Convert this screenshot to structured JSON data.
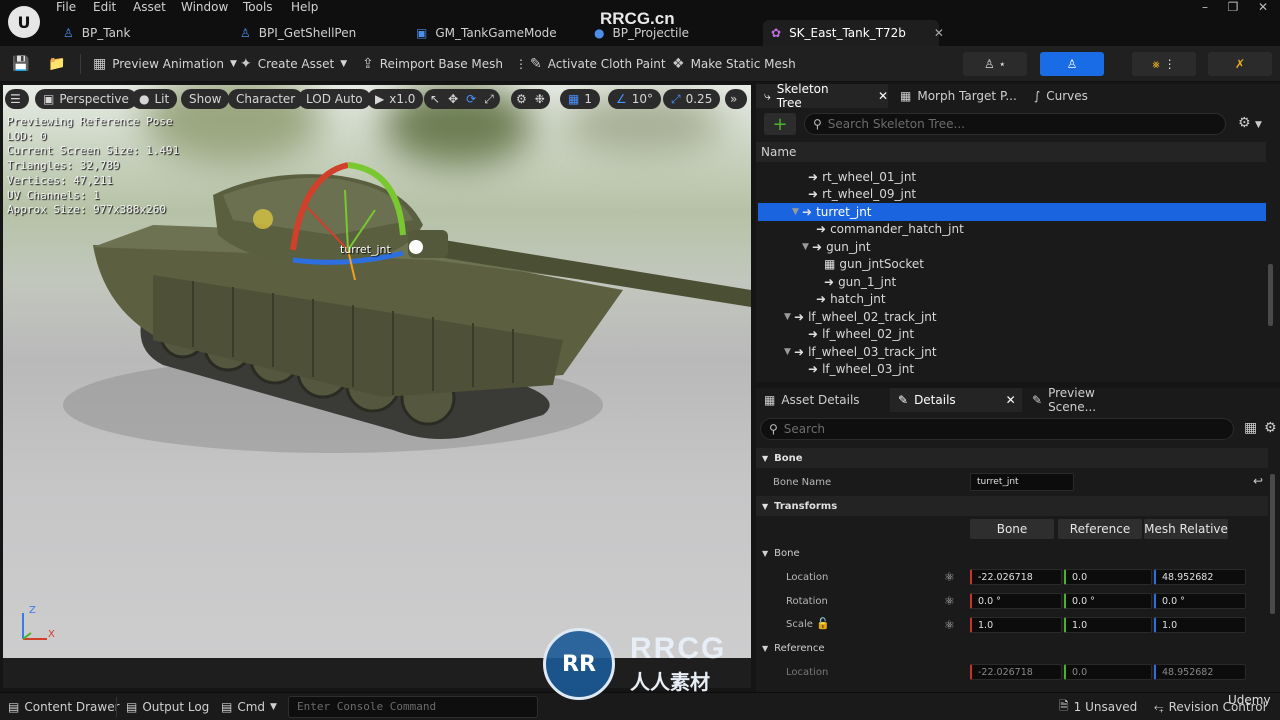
{
  "menu": [
    "File",
    "Edit",
    "Asset",
    "Window",
    "Tools",
    "Help"
  ],
  "doc_tabs": [
    {
      "label": "BP_Tank",
      "icon": "person-blueprint-icon"
    },
    {
      "label": "BPI_GetShellPen",
      "icon": "person-blueprint-icon"
    },
    {
      "label": "GM_TankGameMode",
      "icon": "blueprint-graph-icon"
    },
    {
      "label": "BP_Projectile",
      "icon": "blueprint-icon"
    },
    {
      "label": "SK_East_Tank_T72b",
      "icon": "skeletal-mesh-icon"
    }
  ],
  "watermark_top": "RRCG.cn",
  "toolbar": {
    "preview_animation": "Preview Animation",
    "create_asset": "Create Asset",
    "reimport": "Reimport Base Mesh",
    "cloth_paint": "Activate Cloth Paint",
    "make_static": "Make Static Mesh"
  },
  "viewport": {
    "perspective": "Perspective",
    "lit": "Lit",
    "show": "Show",
    "character": "Character",
    "lod": "LOD Auto",
    "play_rate": "x1.0",
    "grid_size": "1",
    "rotation_snap": "10°",
    "scale_snap": "0.25",
    "stats": [
      "Previewing Reference Pose",
      "LOD: 0",
      "Current Screen Size: 1.491",
      "Triangles: 32,789",
      "Vertices: 47,211",
      "UV Channels: 1",
      "Approx Size: 977x388x260"
    ],
    "bone_label": "turret_jnt",
    "axis_z": "Z",
    "axis_x": "X"
  },
  "skeleton_panel": {
    "tabs": [
      "Skeleton Tree",
      "Morph Target P...",
      "Curves"
    ],
    "search_placeholder": "Search Skeleton Tree...",
    "column_name": "Name",
    "rows": [
      {
        "label": "rt_wheel_01_jnt"
      },
      {
        "label": "rt_wheel_09_jnt"
      },
      {
        "label": "turret_jnt"
      },
      {
        "label": "commander_hatch_jnt"
      },
      {
        "label": "gun_jnt"
      },
      {
        "label": "gun_jntSocket"
      },
      {
        "label": "gun_1_jnt"
      },
      {
        "label": "hatch_jnt"
      },
      {
        "label": "lf_wheel_02_track_jnt"
      },
      {
        "label": "lf_wheel_02_jnt"
      },
      {
        "label": "lf_wheel_03_track_jnt"
      },
      {
        "label": "lf_wheel_03_jnt"
      }
    ]
  },
  "details_panel": {
    "tabs": [
      "Asset Details",
      "Details",
      "Preview Scene..."
    ],
    "search_placeholder": "Search",
    "cat_bone": "Bone",
    "bone_name_label": "Bone Name",
    "bone_name_value": "turret_jnt",
    "cat_transforms": "Transforms",
    "space_buttons": [
      "Bone",
      "Reference",
      "Mesh Relative"
    ],
    "sub_bone": "Bone",
    "location_label": "Location",
    "location": [
      "-22.026718",
      "0.0",
      "48.952682"
    ],
    "rotation_label": "Rotation",
    "rotation": [
      "0.0 °",
      "0.0 °",
      "0.0 °"
    ],
    "scale_label": "Scale",
    "scale": [
      "1.0",
      "1.0",
      "1.0"
    ],
    "sub_reference": "Reference",
    "ref_location_label": "Location",
    "ref_location": [
      "-22.026718",
      "0.0",
      "48.952682"
    ]
  },
  "statusbar": {
    "content_drawer": "Content Drawer",
    "output_log": "Output Log",
    "cmd": "Cmd",
    "console_placeholder": "Enter Console Command",
    "unsaved": "1 Unsaved",
    "revision": "Revision Control"
  },
  "watermark": {
    "logo": "RR",
    "title": "RRCG",
    "subtitle": "人人素材"
  },
  "corner_text": "Udemy",
  "colors": {
    "accent": "#1a64e0",
    "axis_x": "#c8352b",
    "axis_y": "#4bb32a",
    "axis_z": "#2e6fe0"
  }
}
